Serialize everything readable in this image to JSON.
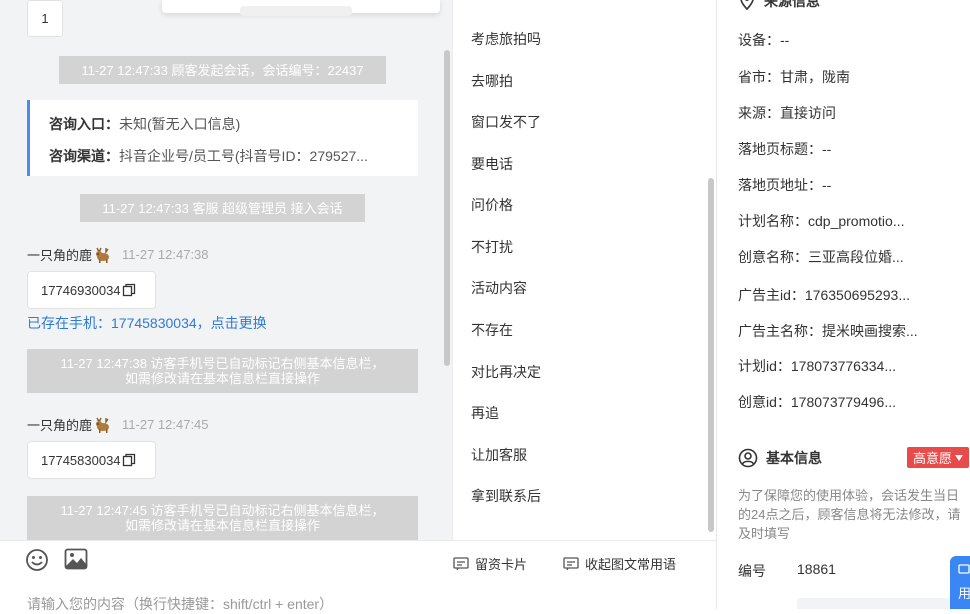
{
  "chat": {
    "top_bubble_text": "1",
    "sys_messages": [
      "11-27 12:47:33 顾客发起会话，会话编号：22437",
      "11-27 12:47:33 客服 超级管理员 接入会话"
    ],
    "consult": {
      "entry_label": "咨询入口：",
      "entry_value": "未知(暂无入口信息)",
      "channel_label": "咨询渠道：",
      "channel_value": "抖音企业号/员工号(抖音号ID：279527..."
    },
    "messages": [
      {
        "sender": "一只角的鹿",
        "time": "11-27 12:47:38",
        "phone": "17746930034"
      },
      {
        "sender": "一只角的鹿",
        "time": "11-27 12:47:45",
        "phone": "17745830034"
      }
    ],
    "exists_phone_link": "已存在手机：17745830034，点击更换",
    "auto_mark_notices": [
      {
        "line1": "11-27 12:47:38 访客手机号已自动标记右侧基本信息栏，",
        "line2": "如需修改请在基本信息栏直接操作"
      },
      {
        "line1": "11-27 12:47:45 访客手机号已自动标记右侧基本信息栏，",
        "line2": "如需修改请在基本信息栏直接操作"
      }
    ]
  },
  "input": {
    "emoji_icon": "smile-icon",
    "image_icon": "image-icon",
    "card_label": "留资卡片",
    "collapse_label": "收起图文常用语",
    "placeholder": "请输入您的内容（换行快捷键：shift/ctrl + enter）"
  },
  "phrases": [
    "考虑旅拍吗",
    "去哪拍",
    "窗口发不了",
    "要电话",
    "问价格",
    "不打扰",
    "活动内容",
    "不存在",
    "对比再决定",
    "再追",
    "让加客服",
    "拿到联系后"
  ],
  "source_info": {
    "title": "来源信息",
    "rows": [
      "设备：--",
      "省市：甘肃，陇南",
      "来源：直接访问",
      "落地页标题：--",
      "落地页地址：--",
      "计划名称：cdp_promotio...",
      "创意名称：三亚高段位婚...",
      "广告主id：176350695293...",
      "广告主名称：提米映画搜索...",
      "计划id：178073776334...",
      "创意id：178073779496..."
    ]
  },
  "basic_info": {
    "title": "基本信息",
    "intent_badge": "高意愿",
    "note": "为了保障您的使用体验，会话发生当日的24点之后，顾客信息将无法修改，请及时填写",
    "id_label": "编号",
    "id_value": "18861",
    "float_button": "用"
  },
  "colors": {
    "accent": "#2e7ad6",
    "badge": "#e94b4b",
    "system_bubble": "#d3d3d3",
    "chat_bg": "#f2f3f5"
  }
}
